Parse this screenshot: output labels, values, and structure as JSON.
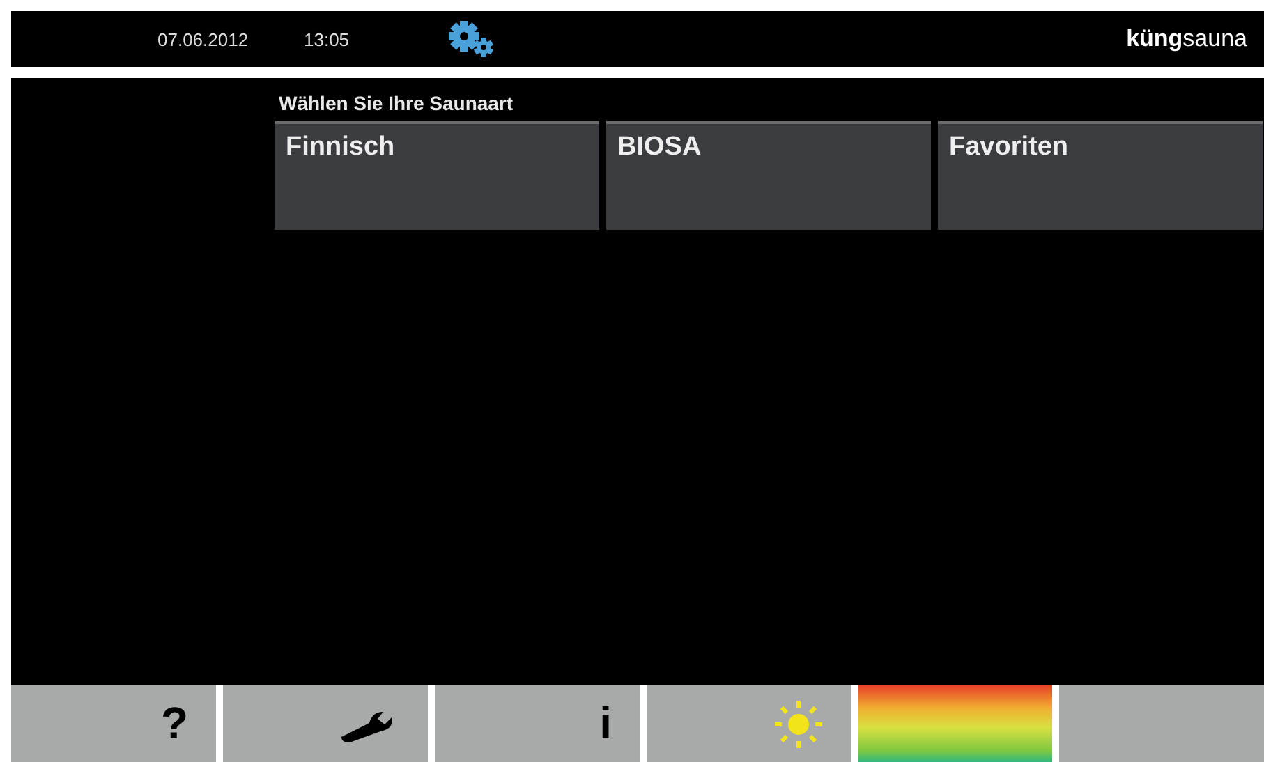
{
  "header": {
    "date": "07.06.2012",
    "time": "13:05",
    "logo": {
      "bold": "küng",
      "light": "sauna"
    }
  },
  "prompt": "Wählen Sie Ihre Saunaart",
  "sauna_types": [
    {
      "label": "Finnisch"
    },
    {
      "label": "BIOSA"
    },
    {
      "label": "Favoriten"
    }
  ],
  "toolbar": [
    {
      "kind": "text",
      "label": "?"
    },
    {
      "kind": "wrench"
    },
    {
      "kind": "text",
      "label": "i"
    },
    {
      "kind": "sun"
    },
    {
      "kind": "color"
    },
    {
      "kind": "blank"
    }
  ]
}
